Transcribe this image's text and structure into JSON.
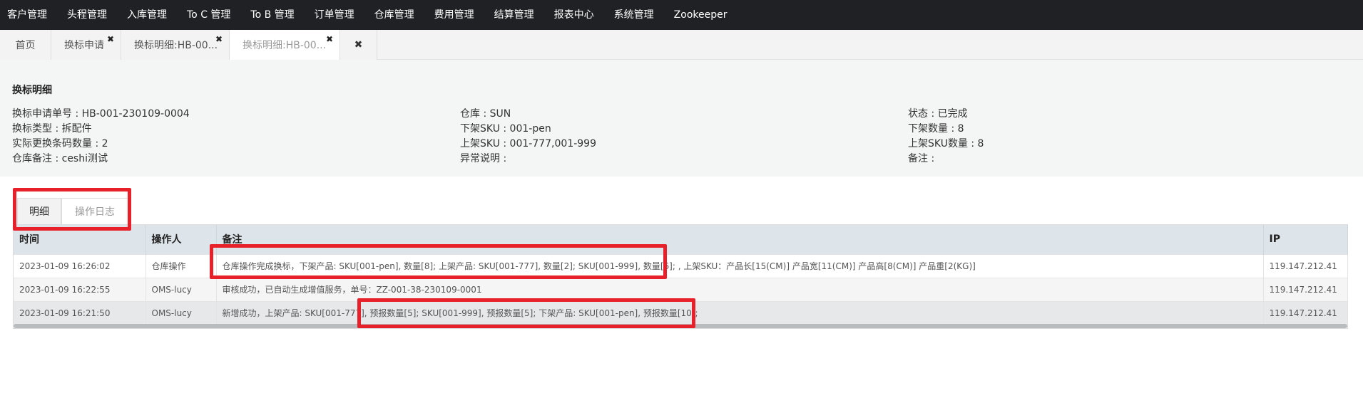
{
  "nav": [
    "客户管理",
    "头程管理",
    "入库管理",
    "To C 管理",
    "To B 管理",
    "订单管理",
    "仓库管理",
    "费用管理",
    "结算管理",
    "报表中心",
    "系统管理",
    "Zookeeper"
  ],
  "tabs": [
    {
      "label": "首页"
    },
    {
      "label": "换标申请"
    },
    {
      "label": "换标明细:HB-00..."
    },
    {
      "label": "换标明细:HB-00..."
    }
  ],
  "close_glyph": "✖",
  "info": {
    "title": "换标明细",
    "fields": [
      [
        "换标申请单号 : HB-001-230109-0004",
        "换标类型 : 拆配件",
        "实际更换条码数量 : 2",
        "仓库备注 : ceshi测试"
      ],
      [
        "仓库 : SUN",
        "下架SKU : 001-pen",
        "上架SKU : 001-777,001-999",
        "异常说明 :"
      ],
      [
        "状态 : 已完成",
        "下架数量 : 8",
        "上架SKU数量 : 8",
        "备注 :"
      ]
    ]
  },
  "subtabs": [
    "明细",
    "操作日志"
  ],
  "table": {
    "headers": [
      "时间",
      "操作人",
      "备注",
      "IP"
    ],
    "rows": [
      [
        "2023-01-09 16:26:02",
        "仓库操作",
        "仓库操作完成换标，下架产品: SKU[001-pen], 数量[8]; 上架产品: SKU[001-777], 数量[2]; SKU[001-999], 数量[6]; , 上架SKU：产品长[15(CM)] 产品宽[11(CM)] 产品高[8(CM)] 产品重[2(KG)]",
        "119.147.212.41"
      ],
      [
        "2023-01-09 16:22:55",
        "OMS-lucy",
        "审核成功，已自动生成增值服务，单号：ZZ-001-38-230109-0001",
        "119.147.212.41"
      ],
      [
        "2023-01-09 16:21:50",
        "OMS-lucy",
        "新增成功，上架产品: SKU[001-777], 预报数量[5]; SKU[001-999], 预报数量[5]; 下架产品: SKU[001-pen], 预报数量[10];",
        "119.147.212.41"
      ]
    ]
  },
  "colors": {
    "highlight": "#e8202a",
    "nav_bg": "#1f2124",
    "header_bg": "#dee5ea"
  }
}
